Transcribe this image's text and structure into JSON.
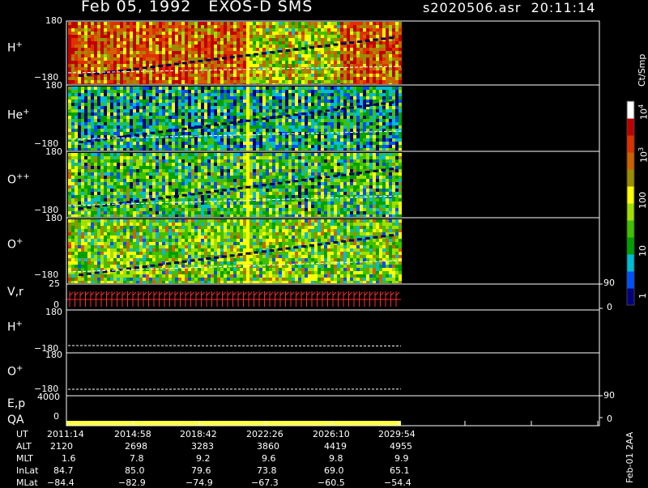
{
  "header": {
    "title": "Feb 05, 1992   EXOS-D SMS",
    "file": "s2020506.asr  20:11:14"
  },
  "colors": {
    "background": "#000000",
    "frame": "#ffffff",
    "trace": "#ffffff",
    "vr_bars": "#ff2a2a",
    "qa_bar": "#ffff40",
    "colorbar": [
      "#000080",
      "#0050ff",
      "#00bcd4",
      "#00a000",
      "#40c000",
      "#a0e000",
      "#ffff00",
      "#9c8c00",
      "#d06000",
      "#e03000",
      "#c00000",
      "#ffffff"
    ]
  },
  "colorbar": {
    "unit": "Ct/Smp",
    "tick_labels": [
      "1",
      "10",
      "100",
      "10",
      "10"
    ],
    "exponents": [
      "",
      "",
      "",
      "3",
      "4"
    ]
  },
  "panels": {
    "hplus_spec": {
      "label": "H",
      "sup": "+",
      "top": "180",
      "bottom": "−180"
    },
    "heplus_spec": {
      "label": "He",
      "sup": "+",
      "top": "180",
      "bottom": "−180"
    },
    "opp_spec": {
      "label": "O",
      "sup": "++",
      "top": "180",
      "bottom": "−180"
    },
    "oplus_spec": {
      "label": "O",
      "sup": "+",
      "top": "180",
      "bottom": "−180"
    },
    "vr": {
      "label": "V,r",
      "top": "25",
      "bottom": "0",
      "right_top": "90",
      "right_bottom": "0"
    },
    "hplus_line": {
      "label": "H",
      "sup": "+",
      "top": "180",
      "bottom": "−180"
    },
    "oplus_line": {
      "label": "O",
      "sup": "+",
      "top": "180",
      "bottom": "−180"
    },
    "ep": {
      "label": "E,p",
      "label2": "QA",
      "top": "4000",
      "bottom": "0",
      "right_top": "90",
      "right_bottom": "0"
    }
  },
  "ephemeris": {
    "labels": [
      "UT",
      "ALT",
      "MLT",
      "InLat",
      "MLat"
    ],
    "columns": [
      {
        "UT": "2011:14",
        "ALT": "2120",
        "MLT": "1.6",
        "InLat": "84.7",
        "MLat": "−84.4"
      },
      {
        "UT": "2014:58",
        "ALT": "2698",
        "MLT": "7.8",
        "InLat": "85.0",
        "MLat": "−82.9"
      },
      {
        "UT": "2018:42",
        "ALT": "3283",
        "MLT": "9.2",
        "InLat": "79.6",
        "MLat": "−74.9"
      },
      {
        "UT": "2022:26",
        "ALT": "3860",
        "MLT": "9.6",
        "InLat": "73.8",
        "MLat": "−67.3"
      },
      {
        "UT": "2026:10",
        "ALT": "4419",
        "MLT": "9.8",
        "InLat": "69.0",
        "MLat": "−60.5"
      },
      {
        "UT": "2029:54",
        "ALT": "4955",
        "MLT": "9.9",
        "InLat": "65.1",
        "MLat": "−54.4"
      }
    ]
  },
  "side_note": "Feb-01 2AA",
  "chart_data": {
    "type": "heatmap",
    "title": "Feb 05, 1992   EXOS-D SMS",
    "x_ticks": [
      "2011:14",
      "2014:58",
      "2018:42",
      "2022:26",
      "2026:10",
      "2029:54"
    ],
    "x_range": [
      "2011:14",
      "2029:54"
    ],
    "data_end": "2029:54",
    "panels": [
      {
        "name": "H+",
        "kind": "pitch-angle spectrogram",
        "ylim": [
          -180,
          180
        ],
        "level": "high (orange/red dominant)"
      },
      {
        "name": "He+",
        "kind": "pitch-angle spectrogram",
        "ylim": [
          -180,
          180
        ],
        "level": "low (blue/green dominant)"
      },
      {
        "name": "O++",
        "kind": "pitch-angle spectrogram",
        "ylim": [
          -180,
          180
        ],
        "level": "low-medium"
      },
      {
        "name": "O+",
        "kind": "pitch-angle spectrogram",
        "ylim": [
          -180,
          180
        ],
        "level": "medium"
      },
      {
        "name": "V,r",
        "kind": "bars",
        "ylim": [
          0,
          25
        ],
        "right_axis": [
          0,
          90
        ]
      },
      {
        "name": "H+",
        "kind": "line",
        "ylim": [
          -180,
          180
        ],
        "start_value": -180,
        "end_value": -160
      },
      {
        "name": "O+",
        "kind": "line",
        "ylim": [
          -180,
          180
        ],
        "start_value": -180,
        "end_value": -155
      },
      {
        "name": "E,p / QA",
        "kind": "flag bar",
        "ylim": [
          0,
          4000
        ],
        "right_axis": [
          0,
          90
        ]
      }
    ],
    "colorbar": {
      "scale": "log",
      "range": [
        1,
        10000
      ],
      "unit": "Ct/Smp"
    },
    "grid": false
  }
}
